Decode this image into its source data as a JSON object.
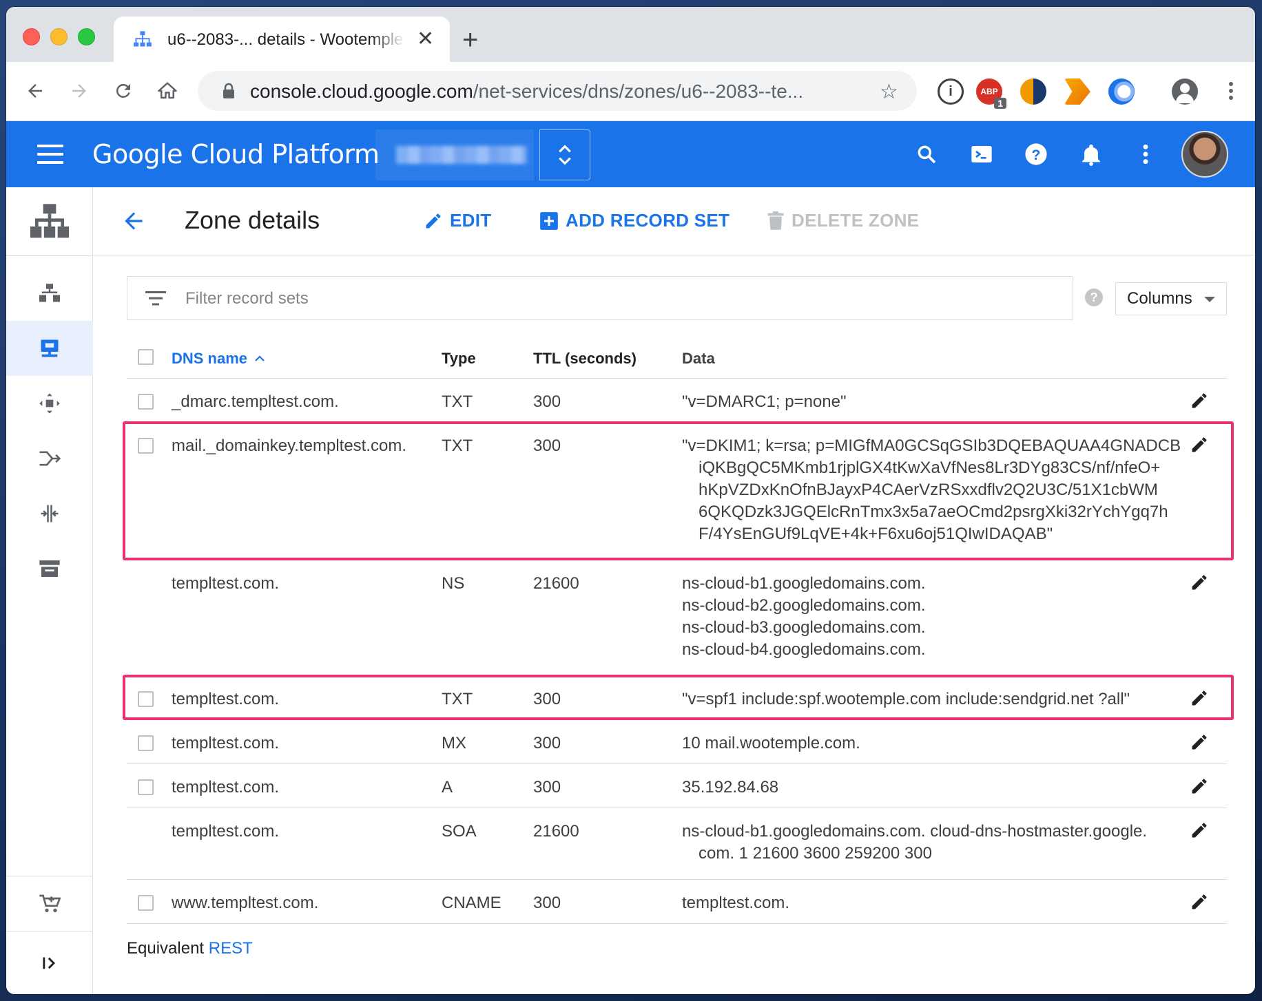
{
  "browser": {
    "tab_title": "u6--2083-... details - Wootemple",
    "tab_close": "✕",
    "new_tab": "+",
    "url_host": "console.cloud.google.com",
    "url_path": "/net-services/dns/zones/u6--2083--te...",
    "extensions": [
      "info-icon",
      "adblock-icon",
      "sync-icon",
      "d3-icon",
      "vpn-icon",
      "profile-icon",
      "more-vert-icon"
    ],
    "adblock_badge": "1",
    "adblock_label": "ABP"
  },
  "header": {
    "app_title": "Google Cloud Platform",
    "project_switch_icon": "unfold-icon",
    "brand_color": "#1a73e8"
  },
  "page": {
    "title": "Zone details",
    "actions": {
      "edit": "EDIT",
      "add_record_set": "ADD RECORD SET",
      "delete_zone": "DELETE ZONE"
    },
    "filter_placeholder": "Filter record sets",
    "help_label": "?",
    "columns_button": "Columns",
    "table": {
      "headers": {
        "dns_name": "DNS name",
        "type": "Type",
        "ttl": "TTL (seconds)",
        "data": "Data"
      },
      "rows": [
        {
          "dns_name": "_dmarc.templtest.com.",
          "type": "TXT",
          "ttl": "300",
          "data": [
            "\"v=DMARC1; p=none\""
          ],
          "has_checkbox": true,
          "highlighted": false
        },
        {
          "dns_name": "mail._domainkey.templtest.com.",
          "type": "TXT",
          "ttl": "300",
          "data": [
            "\"v=DKIM1; k=rsa; p=MIGfMA0GCSqGSIb3DQEBAQUAA4GNADCB",
            "iQKBgQC5MKmb1rjplGX4tKwXaVfNes8Lr3DYg83CS/nf/nfeO+",
            "hKpVZDxKnOfnBJayxP4CAerVzRSxxdflv2Q2U3C/51X1cbWM",
            "6QKQDzk3JGQElcRnTmx3x5a7aeOCmd2psrgXki32rYchYgq7h",
            "F/4YsEnGUf9LqVE+4k+F6xu6oj51QIwIDAQAB\""
          ],
          "has_checkbox": true,
          "highlighted": true
        },
        {
          "dns_name": "templtest.com.",
          "type": "NS",
          "ttl": "21600",
          "data": [
            "ns-cloud-b1.googledomains.com.",
            "ns-cloud-b2.googledomains.com.",
            "ns-cloud-b3.googledomains.com.",
            "ns-cloud-b4.googledomains.com."
          ],
          "has_checkbox": false,
          "highlighted": false
        },
        {
          "dns_name": "templtest.com.",
          "type": "TXT",
          "ttl": "300",
          "data": [
            "\"v=spf1 include:spf.wootemple.com include:sendgrid.net ?all\""
          ],
          "has_checkbox": true,
          "highlighted": true
        },
        {
          "dns_name": "templtest.com.",
          "type": "MX",
          "ttl": "300",
          "data": [
            "10 mail.wootemple.com."
          ],
          "has_checkbox": true,
          "highlighted": false
        },
        {
          "dns_name": "templtest.com.",
          "type": "A",
          "ttl": "300",
          "data": [
            "35.192.84.68"
          ],
          "has_checkbox": true,
          "highlighted": false
        },
        {
          "dns_name": "templtest.com.",
          "type": "SOA",
          "ttl": "21600",
          "data": [
            "ns-cloud-b1.googledomains.com. cloud-dns-hostmaster.google.",
            "com. 1 21600 3600 259200 300"
          ],
          "has_checkbox": false,
          "highlighted": false
        },
        {
          "dns_name": "www.templtest.com.",
          "type": "CNAME",
          "ttl": "300",
          "data": [
            "templtest.com."
          ],
          "has_checkbox": true,
          "highlighted": false
        }
      ]
    },
    "footer": {
      "equivalent_label": "Equivalent",
      "rest_link": "REST"
    }
  },
  "colors": {
    "highlight": "#e9336f",
    "link": "#1a73e8"
  }
}
